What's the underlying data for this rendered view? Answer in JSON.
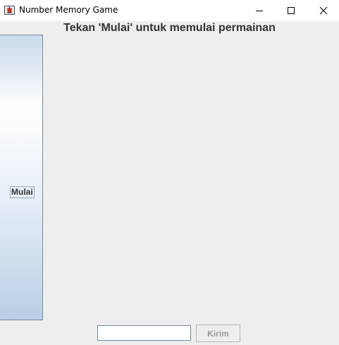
{
  "window": {
    "title": "Number Memory Game",
    "app_icon": "java-cup-icon",
    "controls": [
      "minimize-icon",
      "maximize-icon",
      "close-icon"
    ]
  },
  "main": {
    "status_message": "Tekan 'Mulai' untuk memulai permainan",
    "start_button_label": "Mulai",
    "answer_input_value": "",
    "submit_button_label": "Kirim",
    "submit_enabled": false
  },
  "colors": {
    "background": "#eeeeee",
    "button_gradient_top": "#c9daea",
    "button_gradient_bottom": "#b8cfe5",
    "disabled_text": "#9a9a9a"
  }
}
